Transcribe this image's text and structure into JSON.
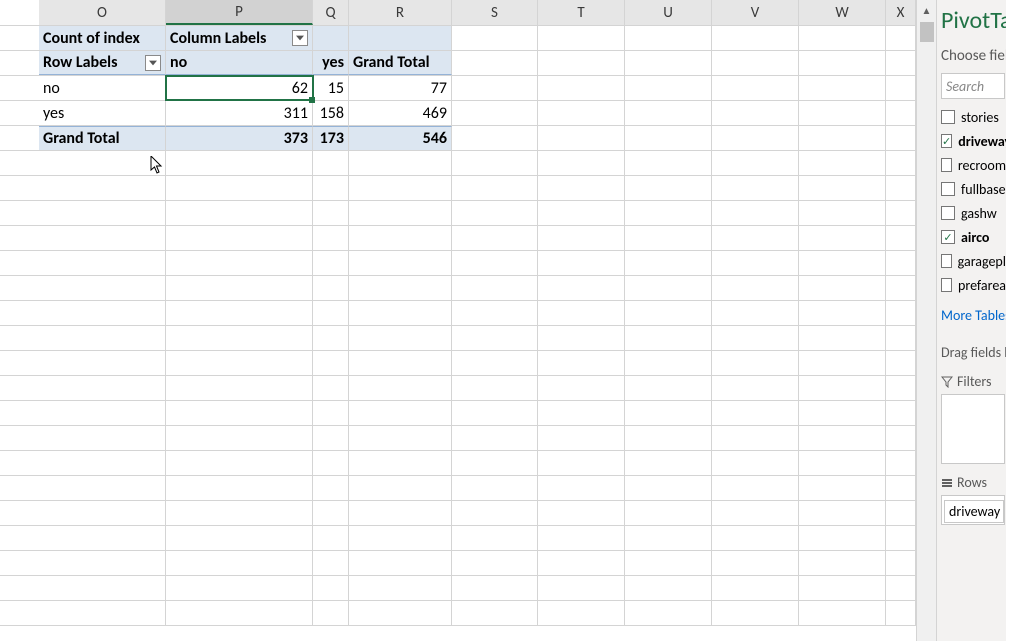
{
  "columns": [
    "O",
    "P",
    "Q",
    "R",
    "S",
    "T",
    "U",
    "V",
    "W",
    "X"
  ],
  "pivot": {
    "measure_label": "Count of index",
    "col_labels_header": "Column Labels",
    "row_labels_header": "Row Labels",
    "col_labels": [
      "no",
      "yes"
    ],
    "grand_total_label": "Grand Total",
    "rows": [
      {
        "label": "no",
        "values": [
          62,
          15
        ],
        "total": 77
      },
      {
        "label": "yes",
        "values": [
          311,
          158
        ],
        "total": 469
      }
    ],
    "grand_totals": {
      "values": [
        373,
        173
      ],
      "total": 546
    }
  },
  "panel": {
    "title": "PivotTable Fields",
    "choose_text": "Choose fields to add to report:",
    "search_placeholder": "Search",
    "fields": [
      {
        "name": "stories",
        "checked": false
      },
      {
        "name": "driveway",
        "checked": true
      },
      {
        "name": "recroom",
        "checked": false
      },
      {
        "name": "fullbase",
        "checked": false
      },
      {
        "name": "gashw",
        "checked": false
      },
      {
        "name": "airco",
        "checked": true
      },
      {
        "name": "garagepl",
        "checked": false
      },
      {
        "name": "prefarea",
        "checked": false
      }
    ],
    "more_tables": "More Tables...",
    "drag_text": "Drag fields between areas below:",
    "filters_label": "Filters",
    "rows_label": "Rows",
    "row_field": "driveway"
  }
}
